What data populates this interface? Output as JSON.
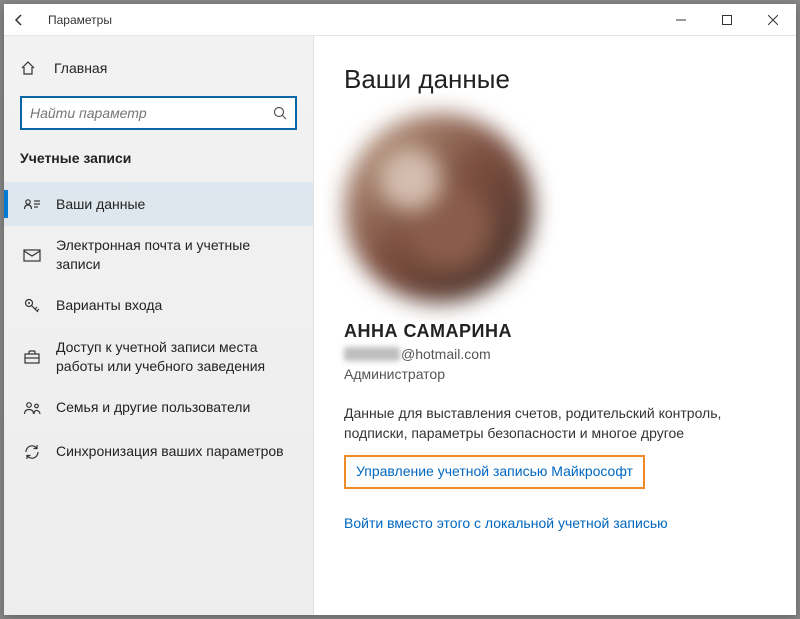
{
  "window": {
    "title": "Параметры"
  },
  "sidebar": {
    "home": "Главная",
    "search_placeholder": "Найти параметр",
    "section_title": "Учетные записи",
    "items": [
      {
        "label": "Ваши данные"
      },
      {
        "label": "Электронная почта и учетные записи"
      },
      {
        "label": "Варианты входа"
      },
      {
        "label": "Доступ к учетной записи места работы или учебного заведения"
      },
      {
        "label": "Семья и другие пользователи"
      },
      {
        "label": "Синхронизация ваших параметров"
      }
    ]
  },
  "content": {
    "heading": "Ваши данные",
    "username": "АННА САМАРИНА",
    "email_domain": "@hotmail.com",
    "role": "Администратор",
    "description": "Данные для выставления счетов, родительский контроль, подписки, параметры безопасности и многое другое",
    "manage_link": "Управление учетной записью Майкрософт",
    "local_link": "Войти вместо этого с локальной учетной записью"
  }
}
